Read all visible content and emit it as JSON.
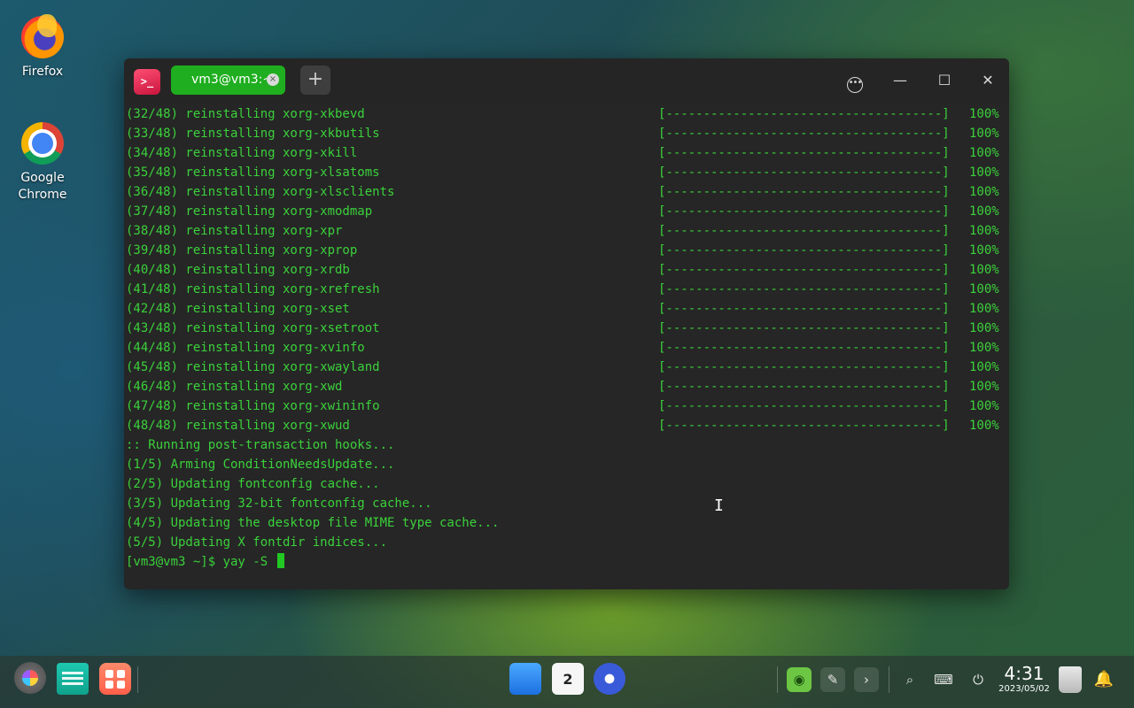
{
  "desktop": {
    "icons": [
      {
        "label": "Firefox",
        "icon": "firefox-icon"
      },
      {
        "label": "Google\nChrome",
        "icon": "chrome-icon"
      }
    ]
  },
  "terminal": {
    "app_icon_glyph": ">_",
    "tab_label": "vm3@vm3:~",
    "tab_close": "×",
    "new_tab": "+",
    "controls": {
      "more": "•••",
      "minimize": "—",
      "maximize": "☐",
      "close": "✕"
    },
    "progress_rows": [
      {
        "step": "(32/48) reinstalling xorg-xkbevd",
        "progress": 100
      },
      {
        "step": "(33/48) reinstalling xorg-xkbutils",
        "progress": 100
      },
      {
        "step": "(34/48) reinstalling xorg-xkill",
        "progress": 100
      },
      {
        "step": "(35/48) reinstalling xorg-xlsatoms",
        "progress": 100
      },
      {
        "step": "(36/48) reinstalling xorg-xlsclients",
        "progress": 100
      },
      {
        "step": "(37/48) reinstalling xorg-xmodmap",
        "progress": 100
      },
      {
        "step": "(38/48) reinstalling xorg-xpr",
        "progress": 100
      },
      {
        "step": "(39/48) reinstalling xorg-xprop",
        "progress": 100
      },
      {
        "step": "(40/48) reinstalling xorg-xrdb",
        "progress": 100
      },
      {
        "step": "(41/48) reinstalling xorg-xrefresh",
        "progress": 100
      },
      {
        "step": "(42/48) reinstalling xorg-xset",
        "progress": 100
      },
      {
        "step": "(43/48) reinstalling xorg-xsetroot",
        "progress": 100
      },
      {
        "step": "(44/48) reinstalling xorg-xvinfo",
        "progress": 100
      },
      {
        "step": "(45/48) reinstalling xorg-xwayland",
        "progress": 100
      },
      {
        "step": "(46/48) reinstalling xorg-xwd",
        "progress": 100
      },
      {
        "step": "(47/48) reinstalling xorg-xwininfo",
        "progress": 100
      },
      {
        "step": "(48/48) reinstalling xorg-xwud",
        "progress": 100
      }
    ],
    "progress_bar": "[-------------------------------------]",
    "progress_text": "100%",
    "hook_lines": [
      ":: Running post-transaction hooks...",
      "(1/5) Arming ConditionNeedsUpdate...",
      "(2/5) Updating fontconfig cache...",
      "(3/5) Updating 32-bit fontconfig cache...",
      "(4/5) Updating the desktop file MIME type cache...",
      "(5/5) Updating X fontdir indices..."
    ],
    "prompt": "[vm3@vm3 ~]$ yay -S ",
    "mouse_cursor": "I"
  },
  "dock": {
    "calendar_day": "2",
    "clock": {
      "time": "4:31",
      "date": "2023/05/02"
    },
    "icons": [
      "launcher-icon",
      "file-manager-icon",
      "app-store-icon",
      "app-installer-icon",
      "calendar-icon",
      "settings-icon",
      "green-tray-icon",
      "pen-icon",
      "expand-arrow-icon",
      "search-icon",
      "keyboard-icon",
      "power-icon",
      "trash-icon",
      "bell-icon"
    ],
    "glyphs": {
      "pen": "✎",
      "arrow": "›",
      "search": "⌕",
      "keyboard": "⌨",
      "power": "⏻",
      "bell": "🔔",
      "green": "◉"
    }
  },
  "colors": {
    "tab_active": "#1fae1f",
    "terminal_text": "#3bd13b",
    "terminal_bg": "#262626"
  }
}
